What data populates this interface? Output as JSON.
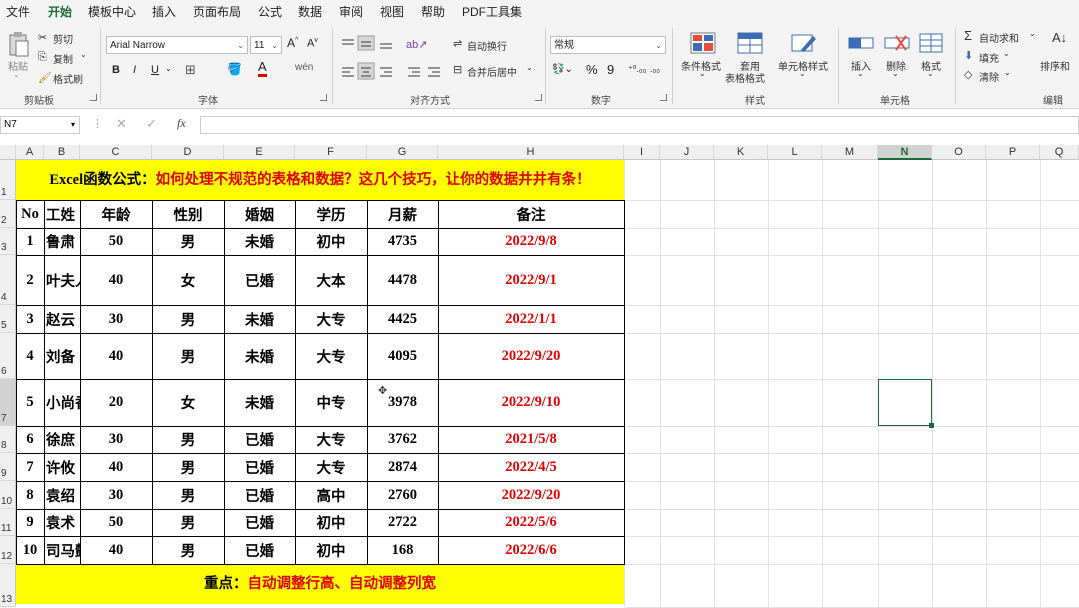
{
  "menu": [
    "文件",
    "开始",
    "模板中心",
    "插入",
    "页面布局",
    "公式",
    "数据",
    "审阅",
    "视图",
    "帮助",
    "PDF工具集"
  ],
  "ribbon": {
    "clipboard": {
      "paste": "粘贴",
      "cut": "剪切",
      "copy": "复制",
      "format_painter": "格式刷",
      "label": "剪贴板"
    },
    "font": {
      "name": "Arial Narrow",
      "size": "11",
      "label": "字体",
      "bold": "B",
      "italic": "I",
      "underline": "U"
    },
    "alignment": {
      "wrap": "自动换行",
      "merge": "合并后居中",
      "label": "对齐方式"
    },
    "number": {
      "format": "常规",
      "label": "数字",
      "percent": "%",
      "comma": "9"
    },
    "styles": {
      "cond": "条件格式",
      "table1": "套用",
      "table2": "表格格式",
      "cell": "单元格样式",
      "label": "样式"
    },
    "cells": {
      "insert": "插入",
      "delete": "删除",
      "format": "格式",
      "label": "单元格"
    },
    "editing": {
      "autosum": "自动求和",
      "fill": "填充",
      "clear": "清除",
      "sort": "排序和",
      "label": "编辑"
    }
  },
  "formula_bar": {
    "name_box": "N7",
    "fx": "fx",
    "value": ""
  },
  "columns": [
    "A",
    "B",
    "C",
    "D",
    "E",
    "F",
    "G",
    "H",
    "I",
    "J",
    "K",
    "L",
    "M",
    "N",
    "O",
    "P",
    "Q"
  ],
  "rows": [
    "1",
    "2",
    "3",
    "4",
    "5",
    "6",
    "7",
    "8",
    "9",
    "10",
    "11",
    "12",
    "13"
  ],
  "sheet": {
    "title_black": "Excel函数公式：",
    "title_red": "如何处理不规范的表格和数据？这几个技巧，让你的数据井井有条！",
    "headers": [
      "No",
      "工姓",
      "年龄",
      "性别",
      "婚姻",
      "学历",
      "月薪",
      "备注"
    ],
    "records": [
      [
        "1",
        "鲁肃",
        "50",
        "男",
        "未婚",
        "初中",
        "4735",
        "2022/9/8"
      ],
      [
        "2",
        "叶夫人",
        "40",
        "女",
        "已婚",
        "大本",
        "4478",
        "2022/9/1"
      ],
      [
        "3",
        "赵云",
        "30",
        "男",
        "未婚",
        "大专",
        "4425",
        "2022/1/1"
      ],
      [
        "4",
        "刘备",
        "40",
        "男",
        "未婚",
        "大专",
        "4095",
        "2022/9/20"
      ],
      [
        "5",
        "小尚香",
        "20",
        "女",
        "未婚",
        "中专",
        "3978",
        "2022/9/10"
      ],
      [
        "6",
        "徐庶",
        "30",
        "男",
        "已婚",
        "大专",
        "3762",
        "2021/5/8"
      ],
      [
        "7",
        "许攸",
        "40",
        "男",
        "已婚",
        "大专",
        "2874",
        "2022/4/5"
      ],
      [
        "8",
        "袁绍",
        "30",
        "男",
        "已婚",
        "高中",
        "2760",
        "2022/9/20"
      ],
      [
        "9",
        "袁术",
        "50",
        "男",
        "已婚",
        "初中",
        "2722",
        "2022/5/6"
      ],
      [
        "10",
        "司马懿",
        "40",
        "男",
        "已婚",
        "初中",
        "168",
        "2022/6/6"
      ]
    ],
    "footer_black": "重点：",
    "footer_red": "自动调整行高、自动调整列宽"
  },
  "colors": {
    "accent": "#1e6b3a",
    "highlight": "#ffff00",
    "red": "#e00000"
  }
}
